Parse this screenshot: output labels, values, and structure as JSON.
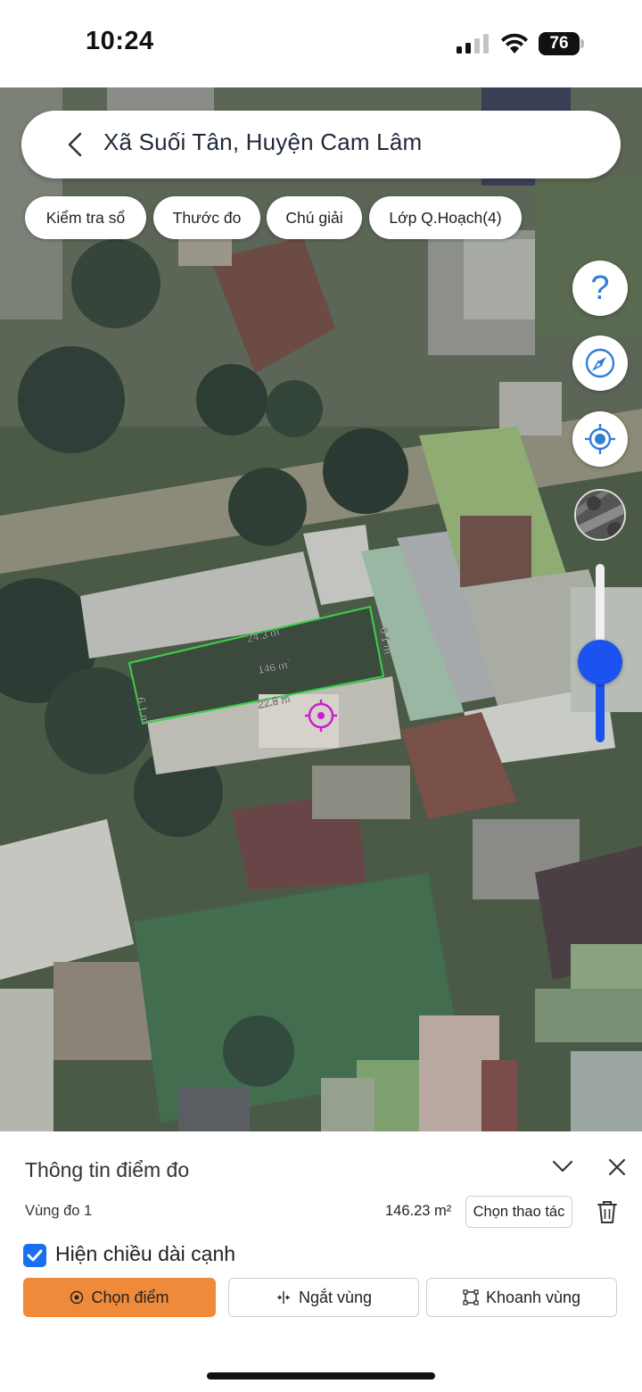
{
  "status_bar": {
    "time": "10:24",
    "battery": "76"
  },
  "search": {
    "title": "Xã Suối Tân, Huyện Cam Lâm"
  },
  "chips": [
    "Kiểm tra sổ",
    "Thước đo",
    "Chú giải",
    "Lớp Q.Hoạch(4)"
  ],
  "controls": {
    "help": "?"
  },
  "measurement": {
    "top_edge": "24.3 m",
    "right_edge": "6.1 m",
    "bottom_edge": "22.8 m",
    "left_edge": "6.1 m",
    "area_label": "146 m",
    "area_sup": "2"
  },
  "zoom": {
    "level": 0.45
  },
  "sheet": {
    "title": "Thông tin điểm đo",
    "region_label": "Vùng đo 1",
    "area": "146.23 m²",
    "action_button": "Chọn thao tác",
    "checkbox_label": "Hiện chiều dài cạnh",
    "checkbox_checked": true,
    "buttons": {
      "choose_point": "Chọn điểm",
      "break_region": "Ngắt vùng",
      "enclose_region": "Khoanh vùng"
    }
  },
  "colors": {
    "accent_blue": "#1a53f0",
    "primary_orange": "#ef8a3a",
    "measure_green": "#39d04a",
    "marker_magenta": "#c81fd0"
  }
}
